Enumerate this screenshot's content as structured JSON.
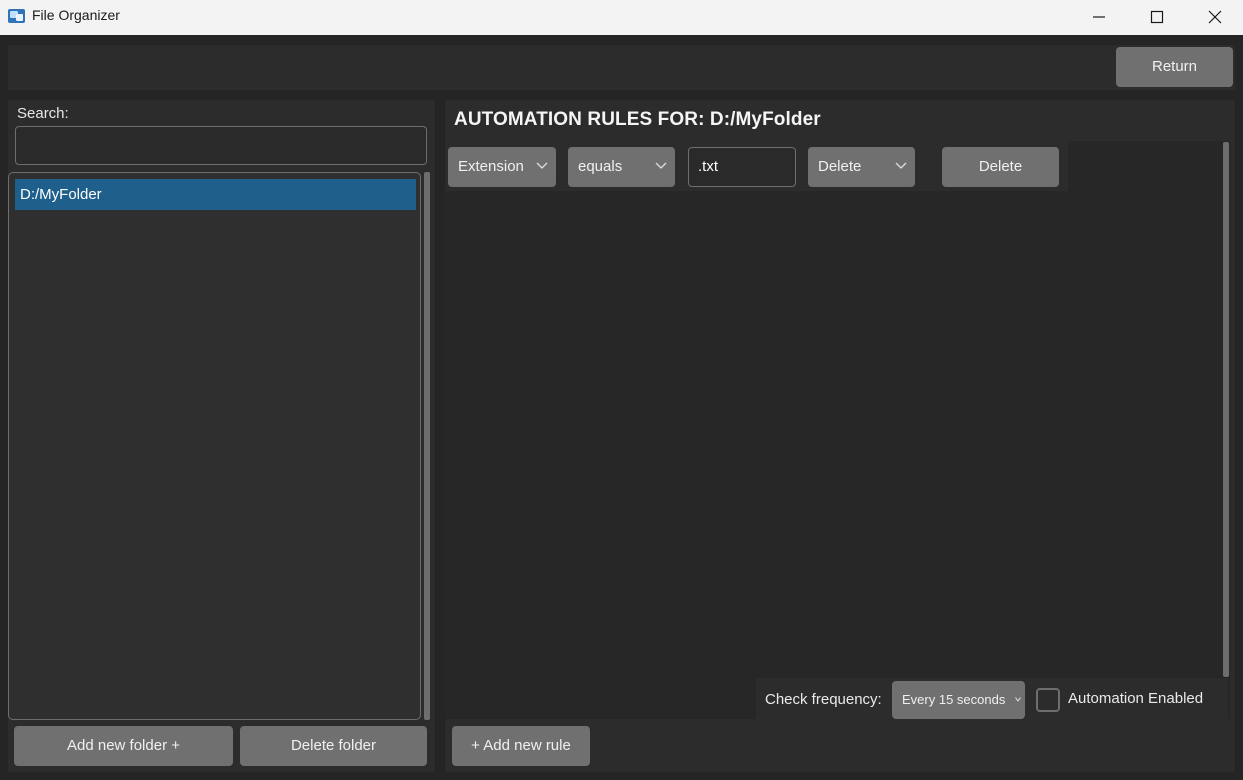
{
  "window": {
    "title": "File Organizer"
  },
  "toolbar": {
    "return_label": "Return"
  },
  "left_panel": {
    "search_label": "Search:",
    "search_value": "",
    "folders": [
      {
        "path": "D:/MyFolder",
        "selected": true
      }
    ],
    "add_folder_label": "Add new folder +",
    "delete_folder_label": "Delete folder"
  },
  "right_panel": {
    "title": "AUTOMATION RULES FOR: D:/MyFolder",
    "rules": [
      {
        "field": "Extension",
        "operator": "equals",
        "value": ".txt",
        "action": "Delete",
        "delete_label": "Delete"
      }
    ],
    "check_frequency_label": "Check frequency:",
    "check_frequency_value": "Every 15 seconds",
    "automation_enabled_label": "Automation Enabled",
    "automation_enabled": false,
    "add_rule_label": "+ Add new rule"
  },
  "colors": {
    "selection": "#1f5f8b",
    "button": "#707070",
    "background": "#252525"
  }
}
